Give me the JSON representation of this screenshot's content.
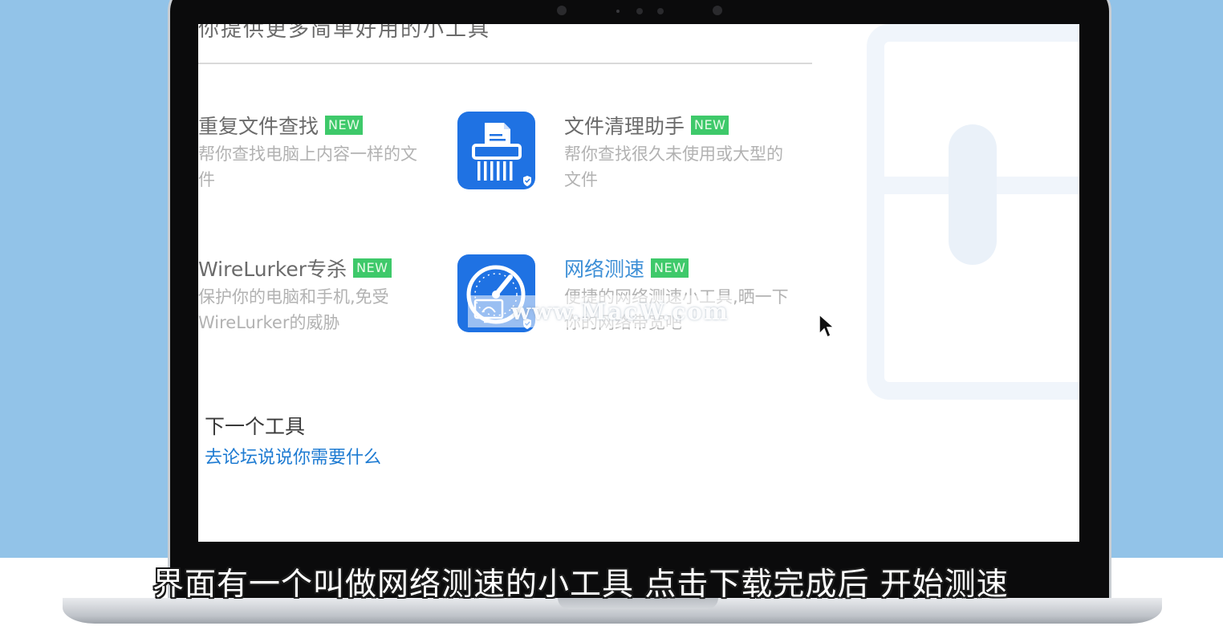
{
  "page_header_partial": "你提供更多简单好用的小工具",
  "tools": [
    {
      "title": "重复文件查找",
      "badge": "NEW",
      "description": "帮你查找电脑上内容一样的文件"
    },
    {
      "title": "文件清理助手",
      "badge": "NEW",
      "description": "帮你查找很久未使用或大型的文件",
      "icon": "shredder-icon"
    },
    {
      "title": "WireLurker专杀",
      "badge": "NEW",
      "description": "保护你的电脑和手机,免受WireLurker的威胁"
    },
    {
      "title": "网络测速",
      "badge": "NEW",
      "description": "便捷的网络测速小工具,晒一下你的网络带宽吧",
      "icon": "speedometer-icon"
    }
  ],
  "next_tool": {
    "title": "下一个工具",
    "link": "去论坛说说你需要什么"
  },
  "watermark": "www.MacW.com",
  "subtitle": "界面有一个叫做网络测速的小工具 点击下载完成后 开始测速",
  "colors": {
    "background": "#92c3e8",
    "icon_blue": "#1f72e3",
    "badge_green": "#3ec96a",
    "link_blue": "#1e7bd2",
    "highlight_title": "#3d8fd6"
  }
}
